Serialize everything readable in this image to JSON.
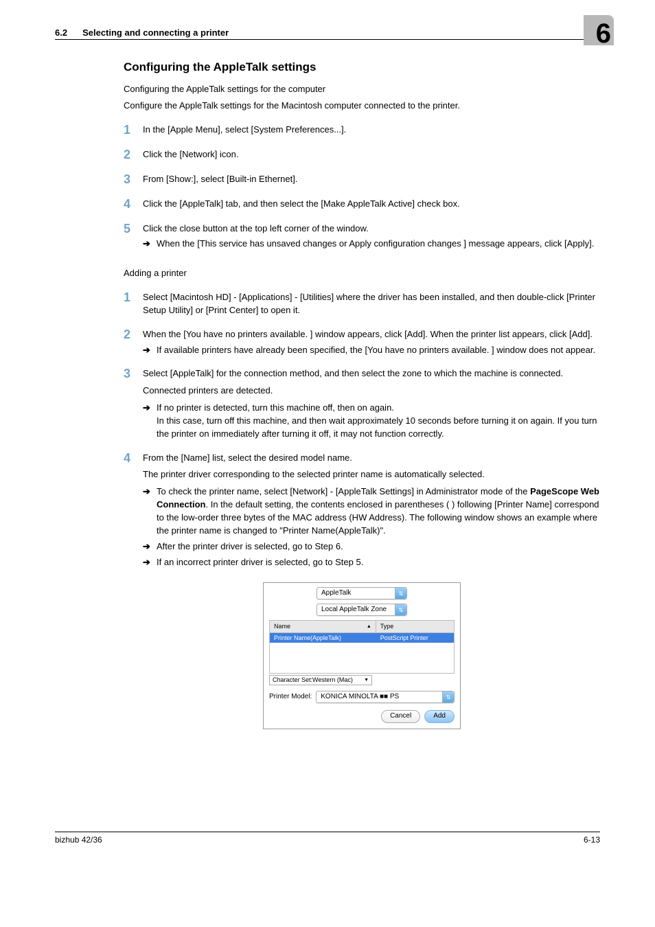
{
  "header": {
    "section_number": "6.2",
    "section_title": "Selecting and connecting a printer",
    "chapter_number": "6"
  },
  "h2": "Configuring the AppleTalk settings",
  "intro1": "Configuring the AppleTalk settings for the computer",
  "intro2": "Configure the AppleTalk settings for the Macintosh computer connected to the printer.",
  "stepsA": {
    "s1": "In the [Apple Menu], select [System Preferences...].",
    "s2": "Click the [Network] icon.",
    "s3": "From [Show:], select [Built-in Ethernet].",
    "s4": "Click the [AppleTalk] tab, and then select the [Make AppleTalk Active] check box.",
    "s5": "Click the close button at the top left corner of the window.",
    "s5_sub": "When the [This service has unsaved changes or Apply configuration changes ] message appears, click [Apply]."
  },
  "subhead": "Adding a printer",
  "stepsB": {
    "s1": "Select [Macintosh HD] - [Applications] - [Utilities] where the driver has been installed, and then double-click [Printer Setup Utility] or [Print Center] to open it.",
    "s2": "When the [You have no printers available. ] window appears, click [Add]. When the printer list appears, click [Add].",
    "s2_sub": "If available printers have already been specified, the [You have no printers available. ] window does not appear.",
    "s3_a": "Select [AppleTalk] for the connection method, and then select the zone to which the machine is connected.",
    "s3_b": "Connected printers are detected.",
    "s3_sub1": "If no printer is detected, turn this machine off, then on again.",
    "s3_sub1b": "In this case, turn off this machine, and then wait approximately 10 seconds before turning it on again. If you turn the printer on immediately after turning it off, it may not function correctly.",
    "s4_a": "From the [Name] list, select the desired model name.",
    "s4_b": "The printer driver corresponding to the selected printer name is automatically selected.",
    "s4_sub1a": "To check the printer name, select [Network] - [AppleTalk Settings] in Administrator mode of the ",
    "s4_sub1_bold": "PageScope Web Connection",
    "s4_sub1b": ". In the default setting, the contents enclosed in parentheses ( ) following [Printer Name] correspond to the low-order three bytes of the MAC address (HW Address). The following window shows an example where the printer name is changed to \"Printer Name(AppleTalk)\".",
    "s4_sub2": "After the printer driver is selected, go to Step 6.",
    "s4_sub3": "If an incorrect printer driver is selected, go to Step 5."
  },
  "shot": {
    "sel1": "AppleTalk",
    "sel2": "Local AppleTalk Zone",
    "col_name": "Name",
    "col_type": "Type",
    "row_name": "Printer Name(AppleTalk)",
    "row_type": "PostScript Printer",
    "charset": "Character Set:Western (Mac)",
    "pm_label": "Printer Model:",
    "pm_value": "KONICA MINOLTA ■■ PS",
    "btn_cancel": "Cancel",
    "btn_add": "Add"
  },
  "footer": {
    "left": "bizhub 42/36",
    "right": "6-13"
  },
  "nums": {
    "n1": "1",
    "n2": "2",
    "n3": "3",
    "n4": "4",
    "n5": "5"
  },
  "arrow": "➔"
}
